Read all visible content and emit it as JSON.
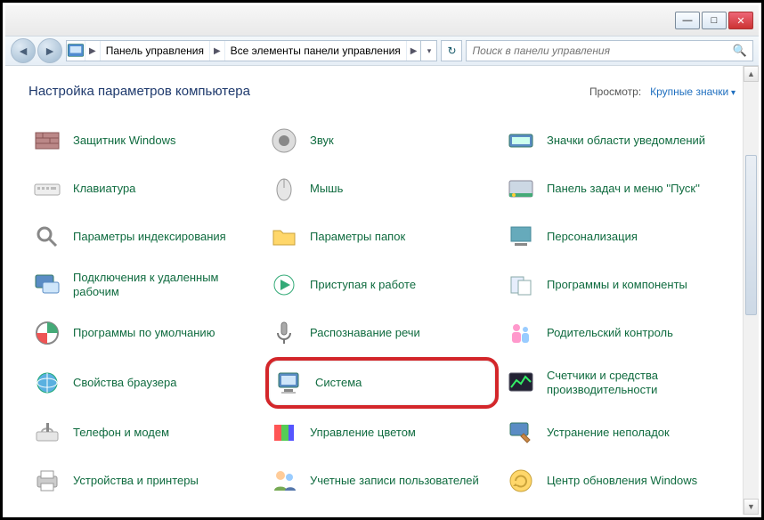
{
  "breadcrumb": {
    "root": "Панель управления",
    "sub": "Все элементы панели управления"
  },
  "search": {
    "placeholder": "Поиск в панели управления"
  },
  "page_title": "Настройка параметров компьютера",
  "view_label": "Просмотр:",
  "view_value": "Крупные значки",
  "items": [
    {
      "label": "Защитник Windows",
      "icon": "brick"
    },
    {
      "label": "Звук",
      "icon": "speaker"
    },
    {
      "label": "Значки области уведомлений",
      "icon": "tray"
    },
    {
      "label": "Клавиатура",
      "icon": "keyboard"
    },
    {
      "label": "Мышь",
      "icon": "mouse"
    },
    {
      "label": "Панель задач и меню ''Пуск''",
      "icon": "taskbar"
    },
    {
      "label": "Параметры индексирования",
      "icon": "index"
    },
    {
      "label": "Параметры папок",
      "icon": "folder"
    },
    {
      "label": "Персонализация",
      "icon": "persona"
    },
    {
      "label": "Подключения к удаленным рабочим",
      "icon": "remote"
    },
    {
      "label": "Приступая к работе",
      "icon": "start"
    },
    {
      "label": "Программы и компоненты",
      "icon": "programs"
    },
    {
      "label": "Программы по умолчанию",
      "icon": "defaults"
    },
    {
      "label": "Распознавание речи",
      "icon": "speech"
    },
    {
      "label": "Родительский контроль",
      "icon": "parent"
    },
    {
      "label": "Свойства браузера",
      "icon": "inet"
    },
    {
      "label": "Система",
      "icon": "system",
      "hl": true
    },
    {
      "label": "Счетчики и средства производительности",
      "icon": "perf"
    },
    {
      "label": "Телефон и модем",
      "icon": "modem"
    },
    {
      "label": "Управление цветом",
      "icon": "color"
    },
    {
      "label": "Устранение неполадок",
      "icon": "trouble"
    },
    {
      "label": "Устройства и принтеры",
      "icon": "printer"
    },
    {
      "label": "Учетные записи пользователей",
      "icon": "users"
    },
    {
      "label": "Центр обновления Windows",
      "icon": "update"
    }
  ]
}
